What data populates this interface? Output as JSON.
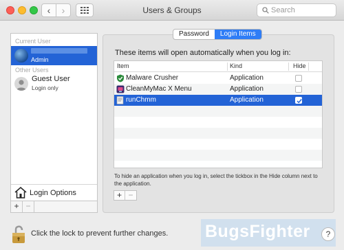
{
  "window": {
    "title": "Users & Groups"
  },
  "search": {
    "placeholder": "Search"
  },
  "sidebar": {
    "current_user_label": "Current User",
    "current_user": {
      "role": "Admin"
    },
    "other_users_label": "Other Users",
    "other_users": [
      {
        "name": "Guest User",
        "status": "Login only"
      }
    ],
    "login_options_label": "Login Options"
  },
  "tabs": [
    {
      "label": "Password",
      "active": false
    },
    {
      "label": "Login Items",
      "active": true
    }
  ],
  "login_items": {
    "intro": "These items will open automatically when you log in:",
    "columns": {
      "item": "Item",
      "kind": "Kind",
      "hide": "Hide"
    },
    "rows": [
      {
        "name": "Malware Crusher",
        "kind": "Application",
        "hide": false,
        "icon": "shield-icon"
      },
      {
        "name": "CleanMyMac X Menu",
        "kind": "Application",
        "hide": false,
        "icon": "cleanmymac-icon"
      },
      {
        "name": "runChmm",
        "kind": "Application",
        "hide": true,
        "icon": "script-icon"
      }
    ],
    "hint": "To hide an application when you log in, select the tickbox in the Hide column next to the application."
  },
  "footer": {
    "lock_text": "Click the lock to prevent further changes.",
    "watermark": "BugsFighter",
    "help": "?"
  }
}
